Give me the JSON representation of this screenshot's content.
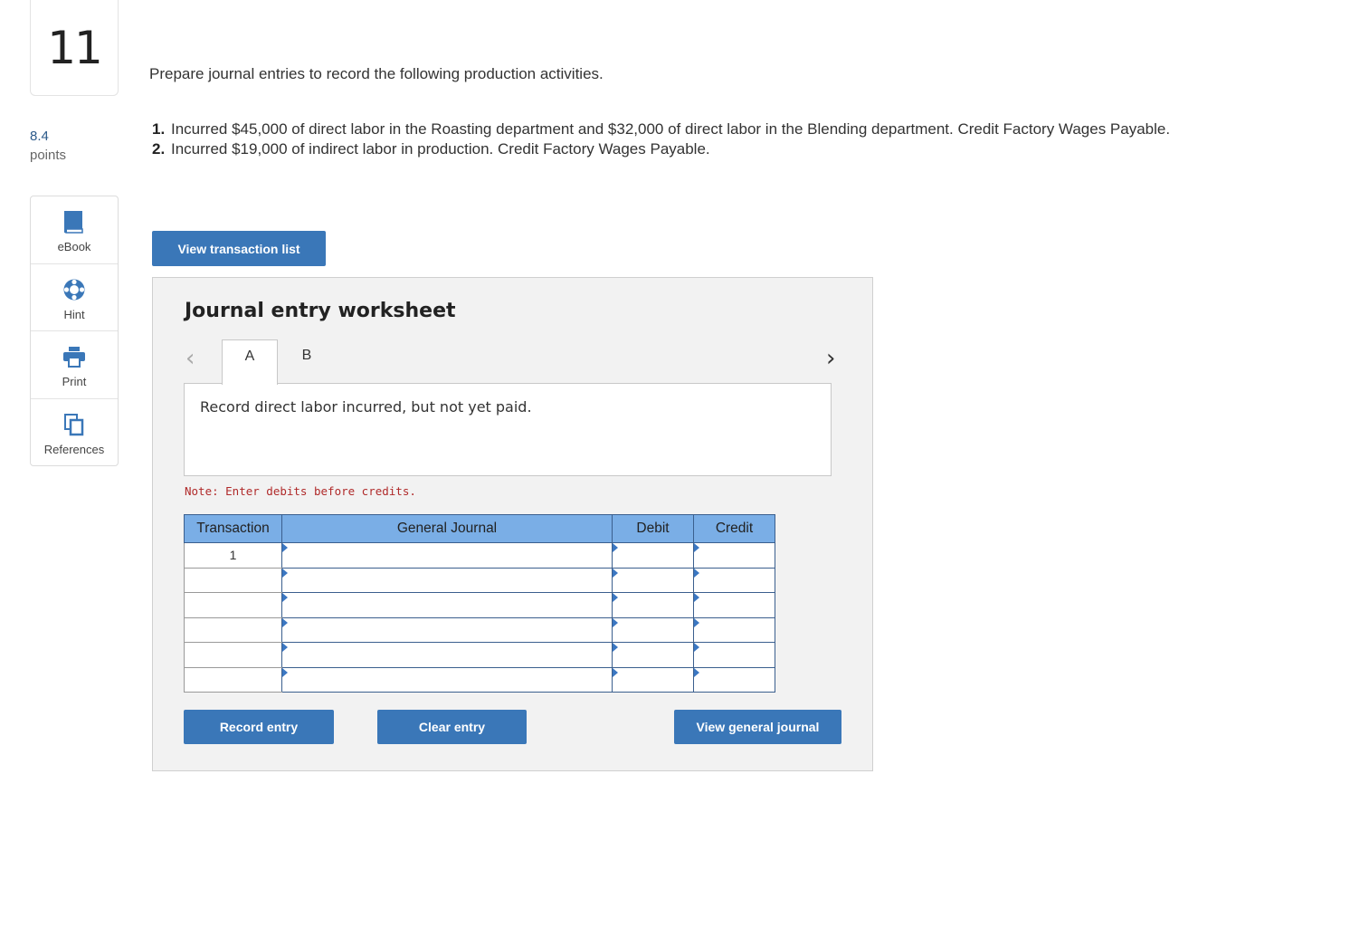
{
  "question": {
    "number": "11",
    "points_value": "8.4",
    "points_label": "points"
  },
  "tools": [
    {
      "label": "eBook",
      "icon": "book-icon"
    },
    {
      "label": "Hint",
      "icon": "lifebuoy-icon"
    },
    {
      "label": "Print",
      "icon": "printer-icon"
    },
    {
      "label": "References",
      "icon": "copy-icon"
    }
  ],
  "prompt": "Prepare journal entries to record the following production activities.",
  "items": [
    {
      "num": "1.",
      "text": "Incurred $45,000 of direct labor in the Roasting department and $32,000 of direct labor in the Blending department. Credit Factory Wages Payable."
    },
    {
      "num": "2.",
      "text": "Incurred $19,000 of indirect labor in production. Credit Factory Wages Payable."
    }
  ],
  "buttons": {
    "view_transaction_list": "View transaction list",
    "record_entry": "Record entry",
    "clear_entry": "Clear entry",
    "view_general_journal": "View general journal"
  },
  "worksheet": {
    "title": "Journal entry worksheet",
    "tabs": [
      "A",
      "B"
    ],
    "active_tab": "A",
    "description": "Record direct labor incurred, but not yet paid.",
    "note": "Note: Enter debits before credits.",
    "columns": [
      "Transaction",
      "General Journal",
      "Debit",
      "Credit"
    ],
    "rows": [
      {
        "transaction": "1",
        "account": "",
        "debit": "",
        "credit": ""
      },
      {
        "transaction": "",
        "account": "",
        "debit": "",
        "credit": ""
      },
      {
        "transaction": "",
        "account": "",
        "debit": "",
        "credit": ""
      },
      {
        "transaction": "",
        "account": "",
        "debit": "",
        "credit": ""
      },
      {
        "transaction": "",
        "account": "",
        "debit": "",
        "credit": ""
      },
      {
        "transaction": "",
        "account": "",
        "debit": "",
        "credit": ""
      }
    ]
  },
  "colors": {
    "button": "#3a77b8",
    "header": "#7aaee6",
    "note": "#b02a2a"
  }
}
